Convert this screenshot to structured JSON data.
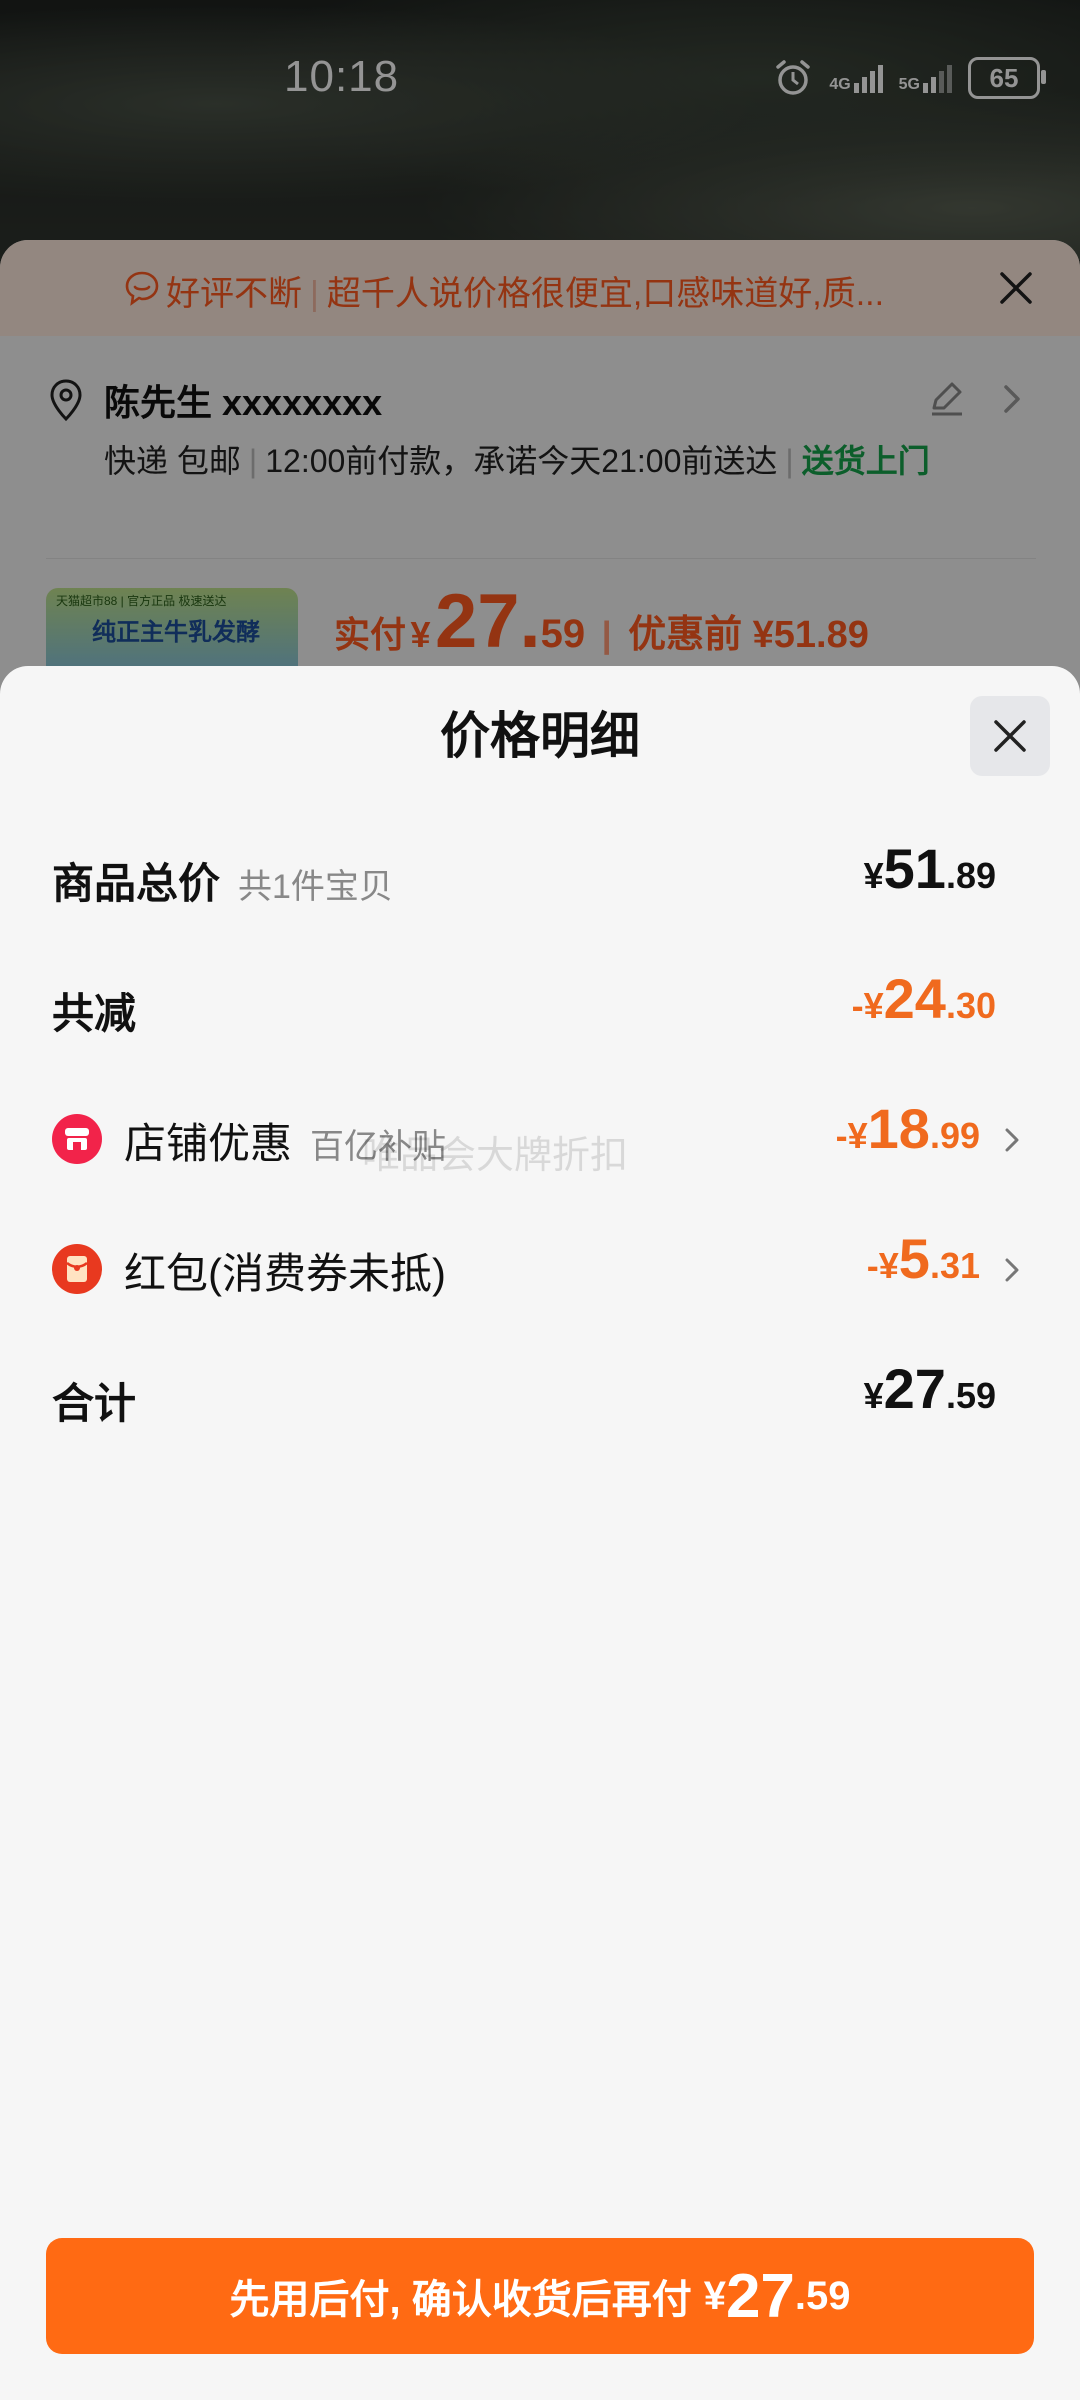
{
  "status_bar": {
    "time": "10:18",
    "network_1": "4G",
    "network_2": "5G",
    "battery": "65"
  },
  "order": {
    "banner": {
      "tag": "好评不断",
      "text": "超千人说价格很便宜,口感味道好,质..."
    },
    "address": {
      "name": "陈先生 xxxxxxxx"
    },
    "delivery": {
      "method": "快递 包邮",
      "promise": "12:00前付款，承诺今天21:00前送达",
      "door": "送货上门"
    },
    "product": {
      "thumb_top": "天猫超市88 | 官方正品 极速送达",
      "thumb_title": "纯正主牛乳发酵"
    },
    "price": {
      "label": "实付",
      "currency": "¥",
      "integer": "27.",
      "decimal": "59",
      "before": "优惠前 ¥51.89"
    }
  },
  "detail": {
    "title": "价格明细",
    "rows": [
      {
        "label": "商品总价",
        "sub": "共1件宝贝",
        "sym": "¥",
        "int": "51",
        "dec": ".89"
      },
      {
        "label": "共减",
        "sym": "-¥",
        "int": "24",
        "dec": ".30"
      },
      {
        "label": "店铺优惠",
        "sub": "百亿补贴",
        "sym": "-¥",
        "int": "18",
        "dec": ".99"
      },
      {
        "label": "红包(消费券未抵)",
        "sym": "-¥",
        "int": "5",
        "dec": ".31"
      },
      {
        "label": "合计",
        "sym": "¥",
        "int": "27",
        "dec": ".59"
      }
    ],
    "watermark": "唯品会大牌折扣"
  },
  "pay_button": {
    "text": "先用后付, 确认收货后再付",
    "sym": "¥",
    "int": "27",
    "dec": ".59"
  },
  "colors": {
    "accent_orange": "#ff6a13",
    "discount_orange": "#f06a1e",
    "success_green": "#15a24a",
    "shop_icon_red": "#f2234a",
    "redpacket_red": "#e8391f"
  }
}
